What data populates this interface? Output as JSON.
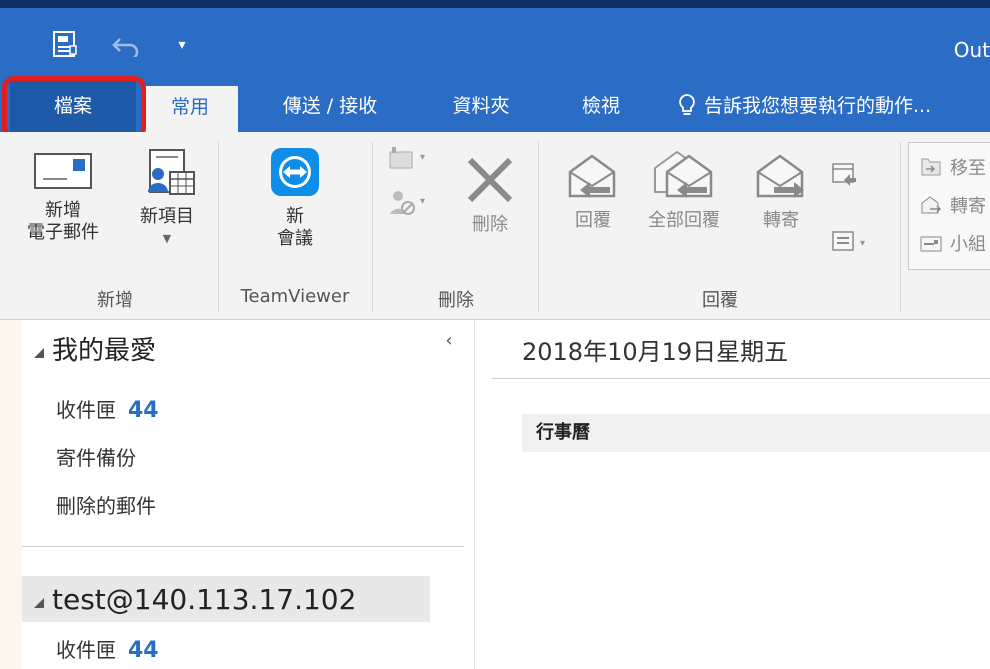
{
  "window": {
    "title": "Out"
  },
  "quick_access": {
    "save_icon": "save-icon",
    "undo_icon": "undo-icon",
    "more_icon": "customize-icon",
    "more_glyph": "▾"
  },
  "tabs": [
    {
      "label": "檔案"
    },
    {
      "label": "常用"
    },
    {
      "label": "傳送 / 接收"
    },
    {
      "label": "資料夾"
    },
    {
      "label": "檢視"
    }
  ],
  "tell_me": {
    "text": "告訴我您想要執行的動作..."
  },
  "ribbon": {
    "new_email": {
      "line1": "新增",
      "line2": "電子郵件"
    },
    "new_items": {
      "line1": "新項目"
    },
    "new_meeting": {
      "line1": "新",
      "line2": "會議"
    },
    "delete": {
      "label": "刪除"
    },
    "reply": {
      "label": "回覆"
    },
    "reply_all": {
      "label": "全部回覆"
    },
    "forward": {
      "label": "轉寄"
    },
    "group_labels": {
      "new": "新增",
      "teamviewer": "TeamViewer",
      "delete": "刪除",
      "respond": "回覆"
    },
    "side_items": [
      "移至",
      "轉寄",
      "小組"
    ]
  },
  "nav": {
    "favorites_title": "我的最愛",
    "collapse_glyph": "‹",
    "favorites": [
      {
        "label": "收件匣",
        "count": "44"
      },
      {
        "label": "寄件備份",
        "count": ""
      },
      {
        "label": "刪除的郵件",
        "count": ""
      }
    ],
    "account": {
      "label": "test@140.113.17.102"
    },
    "account_items": [
      {
        "label": "收件匣",
        "count": "44"
      }
    ]
  },
  "main": {
    "date": "2018年10月19日星期五",
    "calendar_header": "行事曆"
  },
  "colors": {
    "accent": "#2b6cc4",
    "highlight": "#e02020"
  }
}
